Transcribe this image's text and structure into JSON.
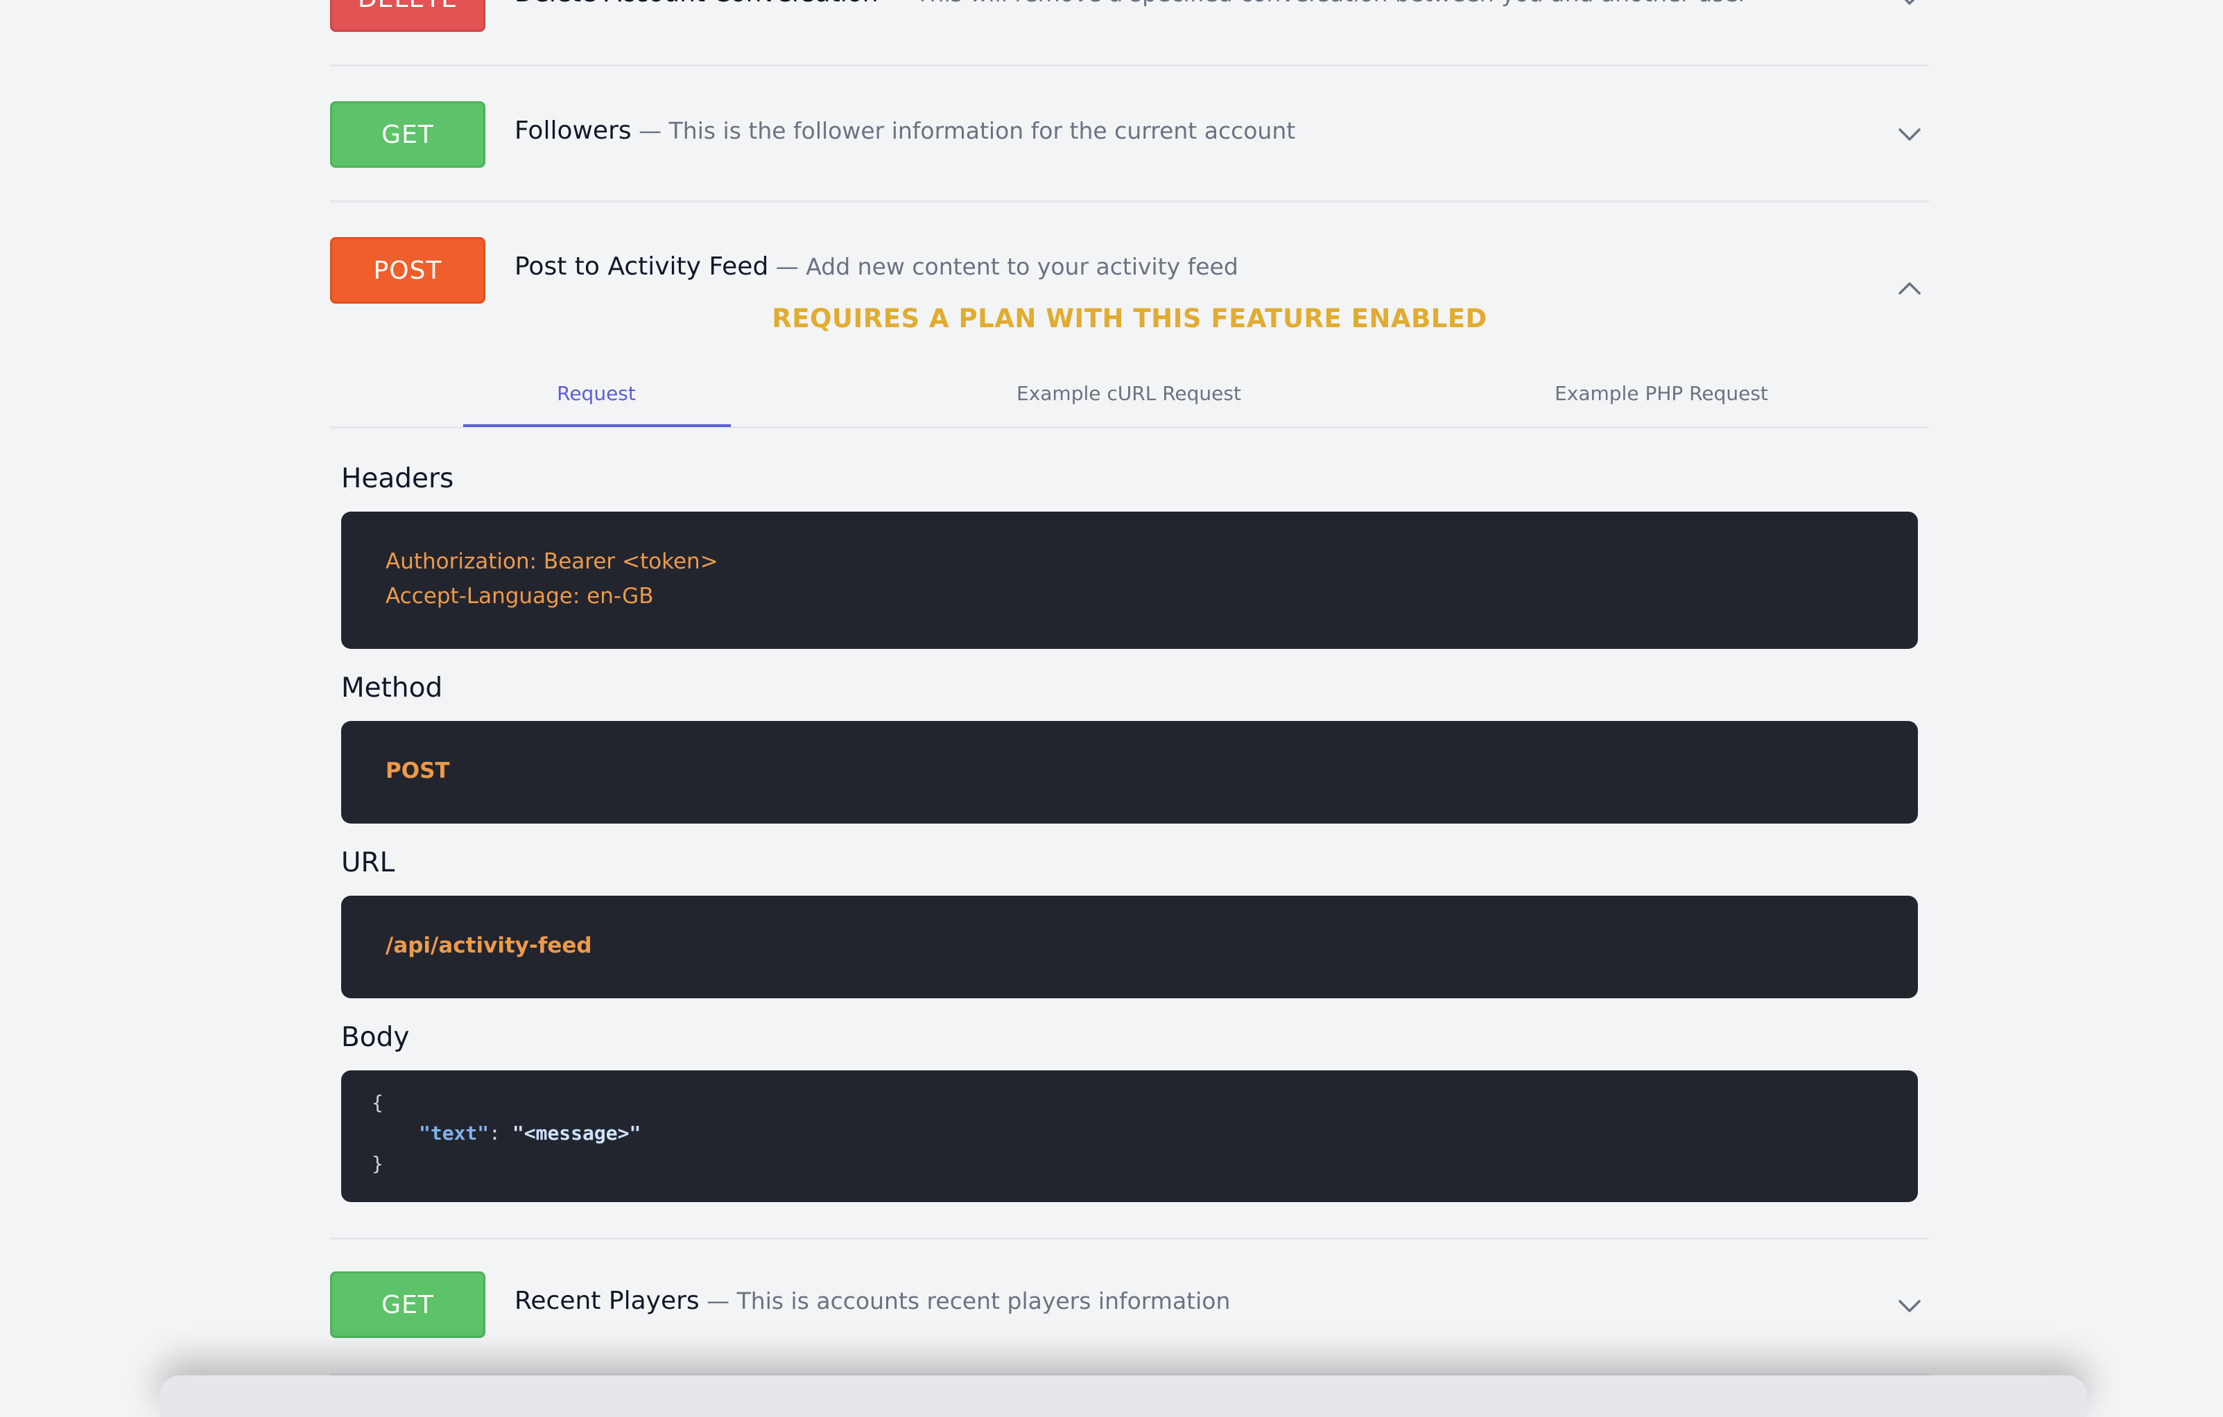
{
  "rows": [
    {
      "method": "DELETE",
      "title": "Delete Account Conversation",
      "desc": " — This will remove a specified conversation between you and another user",
      "expanded": false
    },
    {
      "method": "GET",
      "title": "Followers",
      "desc": " — This is the follower information for the current account",
      "expanded": false
    },
    {
      "method": "POST",
      "title": "Post to Activity Feed",
      "desc": " — Add new content to your activity feed",
      "expanded": true
    },
    {
      "method": "GET",
      "title": "Recent Players",
      "desc": " — This is accounts recent players information",
      "expanded": false
    }
  ],
  "expanded": {
    "plan_note": "REQUIRES A PLAN WITH THIS FEATURE ENABLED",
    "tabs": [
      "Request",
      "Example cURL Request",
      "Example PHP Request"
    ],
    "active_tab": "Request",
    "sections": {
      "headers_label": "Headers",
      "headers_lines": [
        "Authorization: Bearer <token>",
        "Accept-Language: en-GB"
      ],
      "method_label": "Method",
      "method_value": "POST",
      "url_label": "URL",
      "url_value": "/api/activity-feed",
      "body_label": "Body",
      "body_open": "{",
      "body_key": "\"text\"",
      "body_sep": ": ",
      "body_value": "\"<message>\"",
      "body_close": "}"
    }
  },
  "colors": {
    "get": "#5ec26a",
    "post": "#ef5f2b",
    "delete": "#e25454",
    "accent": "#5a5fd6",
    "plan_note": "#e1ac2f",
    "code_bg": "#22252e",
    "code_text": "#ee9a4a"
  },
  "icons": {
    "collapsed": "chevron-down-icon",
    "expanded": "chevron-up-icon"
  }
}
